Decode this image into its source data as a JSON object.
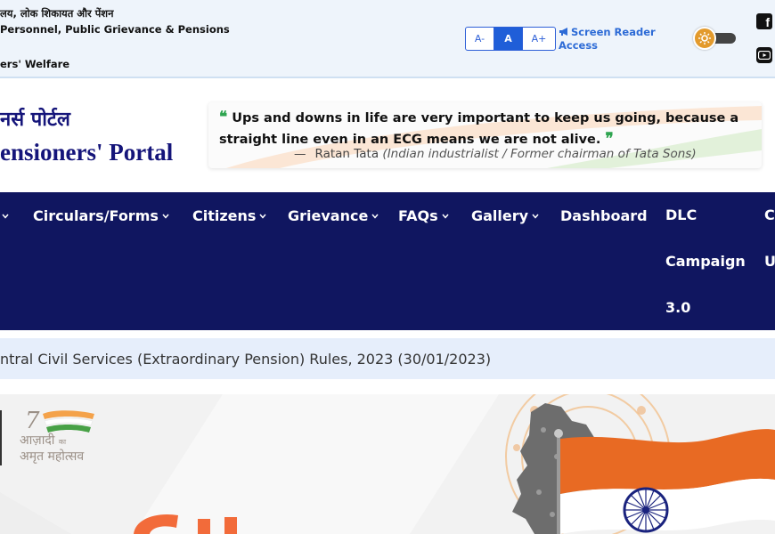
{
  "topbar": {
    "ministry_hi": "लय, लोक शिकायत और पेंशन",
    "ministry_en": "Personnel, Public Grievance & Pensions",
    "department": "ers' Welfare",
    "font_controls": {
      "decrease": "A-",
      "normal": "A",
      "increase": "A+"
    },
    "screen_reader": "Screen Reader Access",
    "social": {
      "facebook_icon": "facebook-icon",
      "youtube_icon": "youtube-icon"
    },
    "colors": {
      "accent": "#1f5ed8",
      "toggle": "#e39a2c"
    }
  },
  "header": {
    "portal_hi": "नर्स पोर्टल",
    "portal_en": "ensioners' Portal",
    "quote": {
      "text": "Ups and downs in life are very important to keep us going, because a straight line even in an ECG means we are not alive.",
      "author": "Ratan Tata",
      "author_role": "(Indian industrialist / Former chairman of Tata Sons)"
    }
  },
  "nav": {
    "items": [
      {
        "label": "Circulars/Forms",
        "dropdown": true
      },
      {
        "label": "Citizens",
        "dropdown": true
      },
      {
        "label": "Grievance",
        "dropdown": true
      },
      {
        "label": "FAQs",
        "dropdown": true
      },
      {
        "label": "Gallery",
        "dropdown": true
      },
      {
        "label": "Dashboard",
        "dropdown": false
      },
      {
        "label_lines": [
          "DLC",
          "Campaign",
          "3.0"
        ],
        "dropdown": false
      }
    ],
    "edge_left_caret": true,
    "edge_right_lines": [
      "C",
      "U"
    ],
    "colors": {
      "background": "#101660"
    }
  },
  "ticker": {
    "text": "ntral Civil Services (Extraordinary Pension) Rules, 2023 (30/01/2023)"
  },
  "banner": {
    "azadi_line1": "आज़ादी",
    "azadi_small": "का",
    "azadi_line2": "अमृत महोत्सव"
  }
}
